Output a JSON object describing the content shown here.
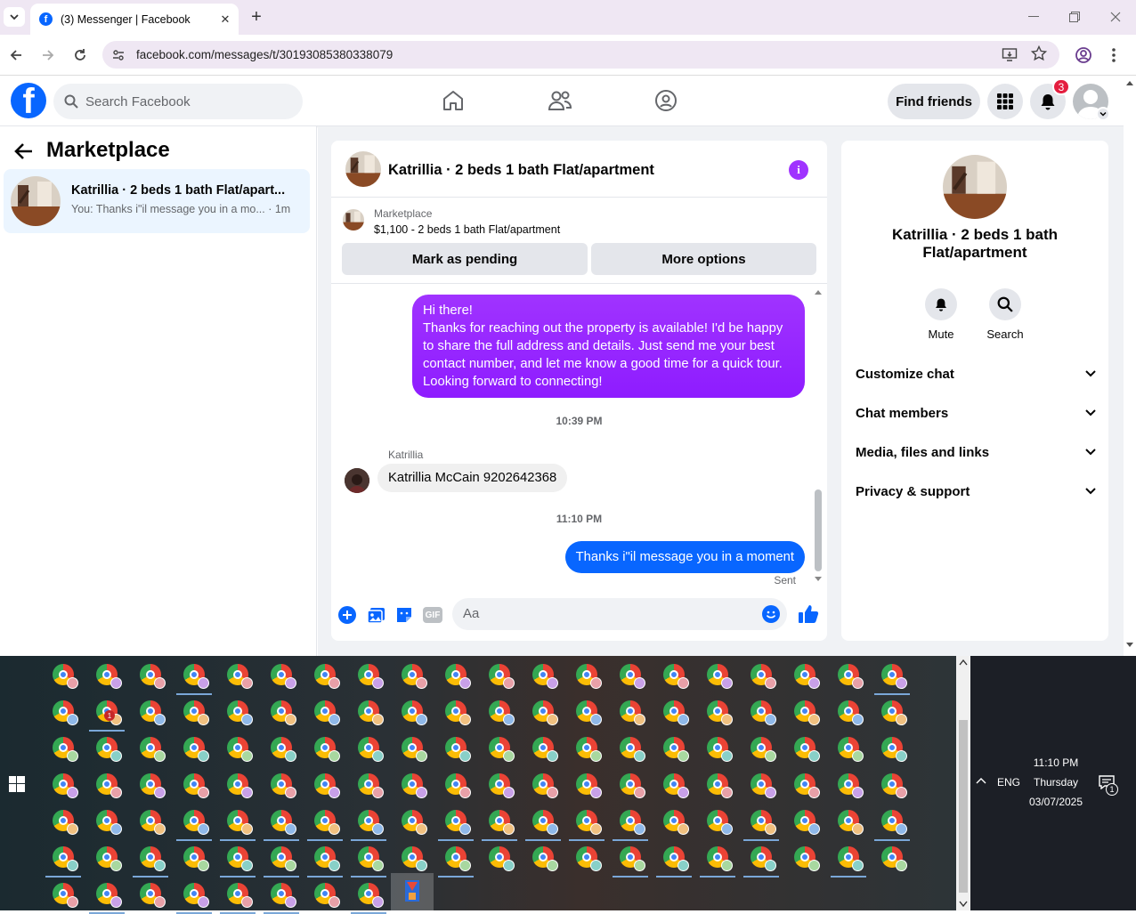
{
  "browser": {
    "tab_title": "(3) Messenger | Facebook",
    "url": "facebook.com/messages/t/30193085380338079"
  },
  "fb_header": {
    "search_placeholder": "Search Facebook",
    "find_friends_label": "Find friends",
    "notifications_count": "3"
  },
  "left_panel": {
    "title": "Marketplace",
    "conversation": {
      "name": "Katrillia · 2 beds 1 bath Flat/apart...",
      "preview": "You: Thanks i\"il message you in a mo... · 1m"
    }
  },
  "chat": {
    "header_name": "Katrillia · 2 beds 1 bath Flat/apartment",
    "listing_source": "Marketplace",
    "listing_price_title": "$1,100 - 2 beds 1 bath Flat/apartment",
    "mark_pending_label": "Mark as pending",
    "more_options_label": "More options",
    "messages": {
      "outgoing_1": [
        "Hi there!",
        "Thanks for reaching out the property is available! I'd be happy",
        "to share the full address and details. Just send me your best",
        "contact number, and let me know a good time for a quick tour.",
        "Looking forward to connecting!"
      ],
      "time_1": "10:39 PM",
      "sender_name": "Katrillia",
      "incoming_1": "Katrillia McCain 9202642368",
      "time_2": "11:10 PM",
      "outgoing_2": "Thanks i\"il message you in a moment",
      "status": "Sent"
    },
    "composer_placeholder": "Aa",
    "gif_label": "GIF"
  },
  "right_panel": {
    "name_line1": "Katrillia · 2 beds 1 bath",
    "name_line2": "Flat/apartment",
    "mute_label": "Mute",
    "search_label": "Search",
    "rows": [
      "Customize chat",
      "Chat members",
      "Media, files and links",
      "Privacy & support"
    ]
  },
  "taskbar": {
    "time": "11:10 PM",
    "day": "Thursday",
    "date": "03/07/2025",
    "lang": "ENG",
    "notification_count": "1",
    "chrome_badge": "1"
  },
  "colors": {
    "fb_blue": "#0866ff",
    "messenger_purple": "#9b1cff",
    "notif_red": "#e41e3f"
  }
}
